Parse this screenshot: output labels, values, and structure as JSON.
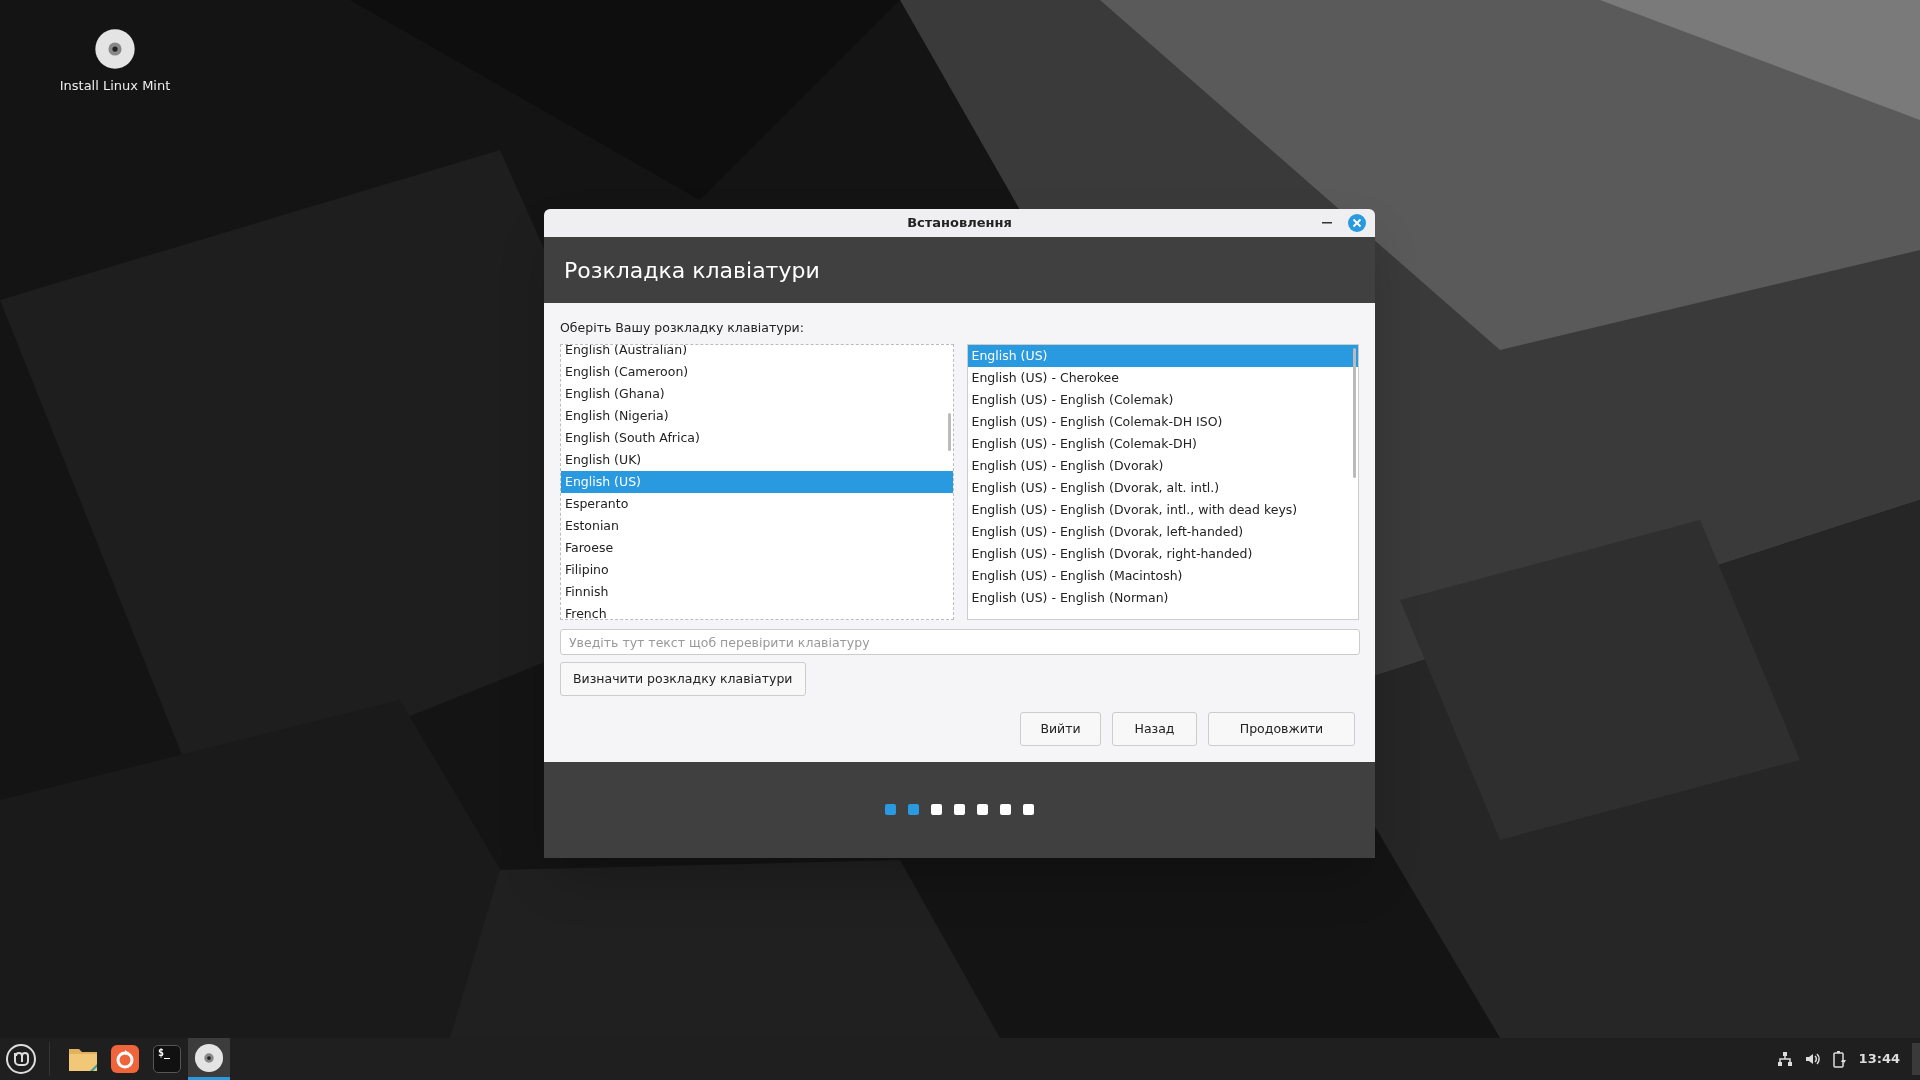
{
  "desktop": {
    "icons": [
      {
        "label": "Install Linux Mint"
      }
    ]
  },
  "window": {
    "title": "Встановлення",
    "heading": "Розкладка клавіатури",
    "prompt": "Оберіть Вашу розкладку клавіатури:",
    "layouts": [
      {
        "label": "English (Australian)",
        "selected": false
      },
      {
        "label": "English (Cameroon)",
        "selected": false
      },
      {
        "label": "English (Ghana)",
        "selected": false
      },
      {
        "label": "English (Nigeria)",
        "selected": false
      },
      {
        "label": "English (South Africa)",
        "selected": false
      },
      {
        "label": "English (UK)",
        "selected": false
      },
      {
        "label": "English (US)",
        "selected": true
      },
      {
        "label": "Esperanto",
        "selected": false
      },
      {
        "label": "Estonian",
        "selected": false
      },
      {
        "label": "Faroese",
        "selected": false
      },
      {
        "label": "Filipino",
        "selected": false
      },
      {
        "label": "Finnish",
        "selected": false
      },
      {
        "label": "French",
        "selected": false
      }
    ],
    "variants": [
      {
        "label": "English (US)",
        "selected": true
      },
      {
        "label": "English (US) - Cherokee",
        "selected": false
      },
      {
        "label": "English (US) - English (Colemak)",
        "selected": false
      },
      {
        "label": "English (US) - English (Colemak-DH ISO)",
        "selected": false
      },
      {
        "label": "English (US) - English (Colemak-DH)",
        "selected": false
      },
      {
        "label": "English (US) - English (Dvorak)",
        "selected": false
      },
      {
        "label": "English (US) - English (Dvorak, alt. intl.)",
        "selected": false
      },
      {
        "label": "English (US) - English (Dvorak, intl., with dead keys)",
        "selected": false
      },
      {
        "label": "English (US) - English (Dvorak, left-handed)",
        "selected": false
      },
      {
        "label": "English (US) - English (Dvorak, right-handed)",
        "selected": false
      },
      {
        "label": "English (US) - English (Macintosh)",
        "selected": false
      },
      {
        "label": "English (US) - English (Norman)",
        "selected": false
      }
    ],
    "test_field": {
      "placeholder": "Уведіть тут текст щоб перевірити клавіатуру"
    },
    "detect_button": "Визначити розкладку клавіатури",
    "buttons": [
      "Вийти",
      "Назад",
      "Продовжити"
    ],
    "steps": [
      {
        "active": true
      },
      {
        "active": true
      },
      {
        "active": false
      },
      {
        "active": false
      },
      {
        "active": false
      },
      {
        "active": false
      },
      {
        "active": false
      }
    ]
  },
  "taskbar": {
    "launchers": [
      {
        "kind": "files",
        "active": false
      },
      {
        "kind": "browser",
        "active": false
      },
      {
        "kind": "terminal",
        "glyph": "$_",
        "active": false
      },
      {
        "kind": "disc",
        "active": true
      }
    ],
    "clock": "13:44"
  }
}
